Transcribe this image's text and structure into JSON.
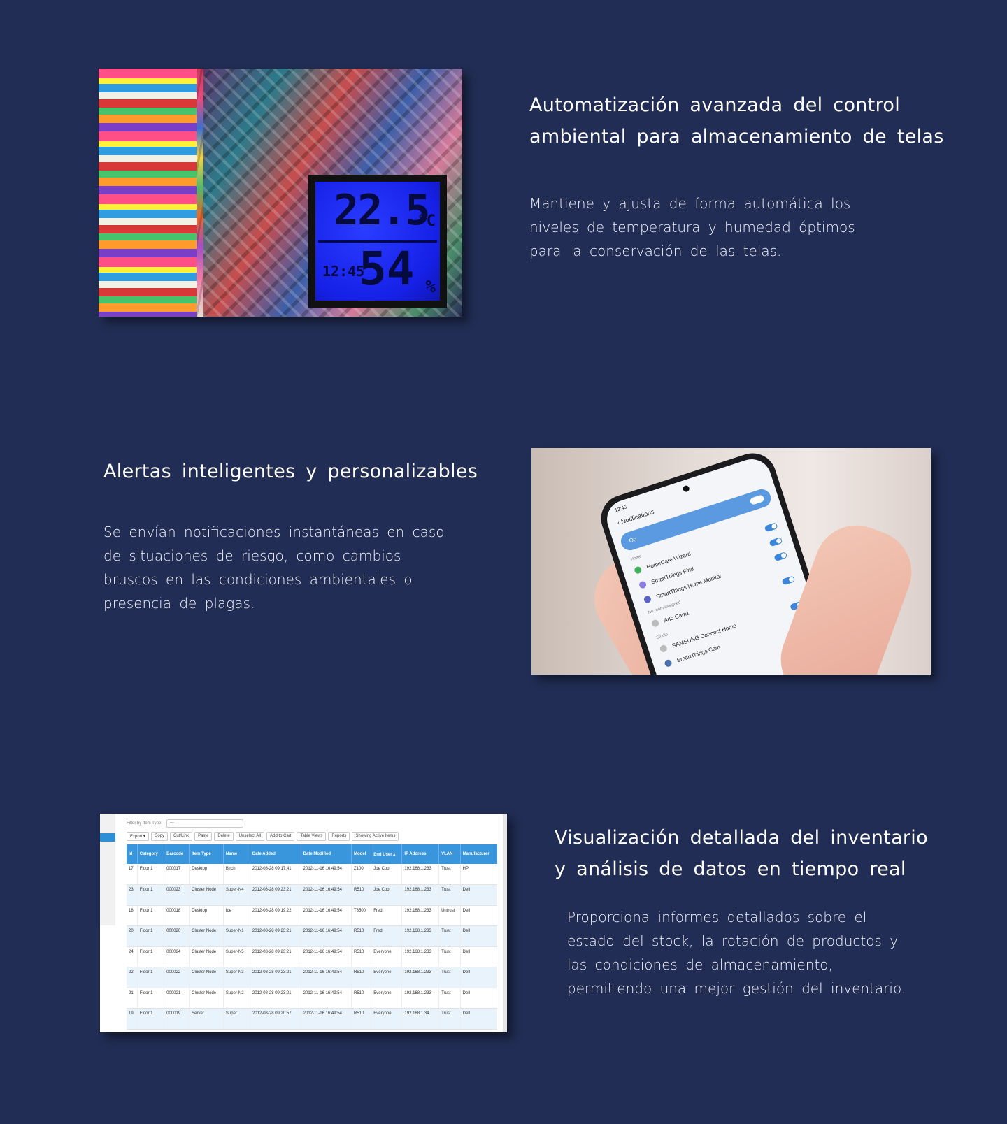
{
  "sections": [
    {
      "title_lines": [
        "Automatización avanzada del control",
        "ambiental para almacenamiento de telas"
      ],
      "body_lines": [
        "Mantiene y ajusta de forma automática los",
        "niveles de temperatura y humedad óptimos",
        "para la conservación de las telas."
      ],
      "image": {
        "temperature": "22.5",
        "temperature_unit": "°C",
        "time": "12:45",
        "humidity": "54",
        "humidity_unit": "%"
      }
    },
    {
      "title_lines": [
        "Alertas inteligentes y personalizables"
      ],
      "body_lines": [
        "Se envían notificaciones instantáneas en caso",
        "de situaciones de riesgo, como cambios",
        "bruscos en las condiciones ambientales o",
        "presencia de plagas."
      ],
      "image": {
        "status_time": "12:45",
        "header": "Notifications",
        "on_label": "On",
        "groups": [
          {
            "label": "Home",
            "items": [
              "HomeCare Wizard",
              "SmartThings Find",
              "SmartThings Home Monitor"
            ]
          },
          {
            "label": "No room assigned",
            "items": [
              "Arlo Cam1"
            ]
          },
          {
            "label": "Studio",
            "items": [
              "SAMSUNG Connect Home",
              "SmartThings Cam"
            ]
          }
        ]
      }
    },
    {
      "title_lines": [
        "Visualización detallada del inventario",
        "y análisis de datos en tiempo real"
      ],
      "body_lines": [
        "Proporciona informes detallados sobre el",
        "estado del stock, la rotación de productos y",
        "las condiciones de almacenamiento,",
        "permitiendo una mejor gestión del inventario."
      ],
      "image": {
        "filter_label": "Filter by Item Type:",
        "filter_value": "---",
        "toolbar": [
          "Export ▾",
          "Copy",
          "Cut/Link",
          "Paste",
          "Delete",
          "Unselect All",
          "Add to Cart",
          "Table Views",
          "Reports",
          "Showing Active Items"
        ],
        "columns": [
          "Id",
          "Category",
          "Barcode",
          "Item Type",
          "Name",
          "Date Added",
          "Date Modified",
          "Model",
          "End User ▴",
          "IP Address",
          "VLAN",
          "Manufacturer"
        ],
        "rows": [
          [
            "17",
            "Floor 1",
            "000017",
            "Desktop",
            "Birch",
            "2012-08-28 09:17:41",
            "2012-11-16 16:49:54",
            "Z100",
            "Joe Cool",
            "192.168.1.233",
            "Trust",
            "HP"
          ],
          [
            "23",
            "Floor 1",
            "000023",
            "Cluster Node",
            "Super-N4",
            "2012-08-28 09:23:21",
            "2012-11-16 16:49:54",
            "R510",
            "Joe Cool",
            "192.168.1.233",
            "Trust",
            "Dell"
          ],
          [
            "18",
            "Floor 1",
            "000018",
            "Desktop",
            "Ice",
            "2012-08-28 09:19:22",
            "2012-11-16 16:49:54",
            "T3500",
            "Fred",
            "192.168.1.233",
            "Untrust",
            "Dell"
          ],
          [
            "20",
            "Floor 1",
            "000020",
            "Cluster Node",
            "Super-N1",
            "2012-08-28 09:23:21",
            "2012-11-16 16:49:54",
            "R510",
            "Fred",
            "192.168.1.233",
            "Trust",
            "Dell"
          ],
          [
            "24",
            "Floor 1",
            "000024",
            "Cluster Node",
            "Super-N5",
            "2012-08-28 09:23:21",
            "2012-11-16 16:49:54",
            "R510",
            "Everyone",
            "192.168.1.233",
            "Trust",
            "Dell"
          ],
          [
            "22",
            "Floor 1",
            "000022",
            "Cluster Node",
            "Super-N3",
            "2012-08-28 09:23:21",
            "2012-11-16 16:49:54",
            "R510",
            "Everyone",
            "192.168.1.233",
            "Trust",
            "Dell"
          ],
          [
            "21",
            "Floor 1",
            "000021",
            "Cluster Node",
            "Super-N2",
            "2012-08-28 09:23:21",
            "2012-11-16 16:49:54",
            "R510",
            "Everyone",
            "192.168.1.233",
            "Trust",
            "Dell"
          ],
          [
            "19",
            "Floor 1",
            "000019",
            "Server",
            "Super",
            "2012-08-28 09:20:57",
            "2012-11-16 16:49:54",
            "R510",
            "Everyone",
            "192.168.1.34",
            "Trust",
            "Dell"
          ]
        ]
      }
    }
  ],
  "colors": {
    "background": "#212d54",
    "text": "#ffffff",
    "table_header": "#3a96dc",
    "lcd_screen": "#1620e6"
  }
}
